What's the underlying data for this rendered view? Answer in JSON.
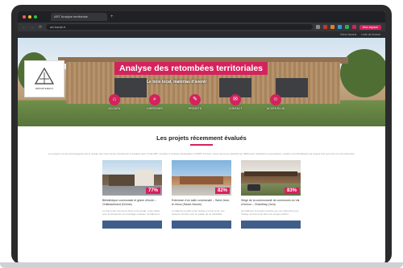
{
  "browser": {
    "tab_title": "ART Analyse territoriale",
    "tab_plus": "+",
    "url": "art-haute.fr",
    "nav_back": "←",
    "nav_forward": "→",
    "nav_reload": "⟳",
    "account_button": "Mon espace",
    "bookmarks": [
      "Gérer favoris",
      "Liste de lecture"
    ],
    "dot_colors": [
      "#ff5f57",
      "#febc2e",
      "#28c840"
    ],
    "ext_colors": [
      "#888888",
      "#c0392b",
      "#e67e22",
      "#3498db",
      "#27ae60",
      "#d4225d"
    ]
  },
  "hero": {
    "title": "Analyse des retombées territoriales",
    "subtitle": "Le bois local, matériau d'avenir",
    "logo_text": "DÉPARTEMENT",
    "icons": [
      {
        "glyph": "⌂",
        "label": "ACCUEIL",
        "name": "home-icon"
      },
      {
        "glyph": "⌕",
        "label": "CHERCHER",
        "name": "search-icon"
      },
      {
        "glyph": "✎",
        "label": "PROJETS",
        "name": "edit-icon"
      },
      {
        "glyph": "✉",
        "label": "CONTACT",
        "name": "mail-icon"
      },
      {
        "glyph": "☺",
        "label": "ACCÈS ÉLUS",
        "name": "user-icon"
      }
    ]
  },
  "projects": {
    "title": "Les projets récemment évalués",
    "intro": "Les projets ont été accompagnés par le réseau des Communes Forestières et évalués avec l'outil ART, comptez 3 minutes d'évaluation à %ART à l'issue. Nous avons pu sélectionner différentes réalisations exemplaires, variées et territorialisées de projets bois qui vous ont été présentés.",
    "cards": [
      {
        "percent": "77%",
        "title": "Bibliothèque communale et grâce d'école – Châteaubriand (Drôme)",
        "desc": "Le bois local, issu de la forêt communale, a été utilisé pour la charpente et le bardage extérieur du bâtiment."
      },
      {
        "percent": "82%",
        "title": "Extension d'un salle communale – Saint-Jean-le-Vieux (Haute-Savoie)",
        "desc": "Le bâtiment public a été réalisé en bois local, une essence choisie pour la qualité de sa durabilité."
      },
      {
        "percent": "83%",
        "title": "Siège de la communauté de communes du Val d'Amour – Chamblay (Jura)",
        "desc": "Ce bâtiment à énergie positive est une référence pour l'usage du bois local dans les projets publics."
      }
    ]
  }
}
